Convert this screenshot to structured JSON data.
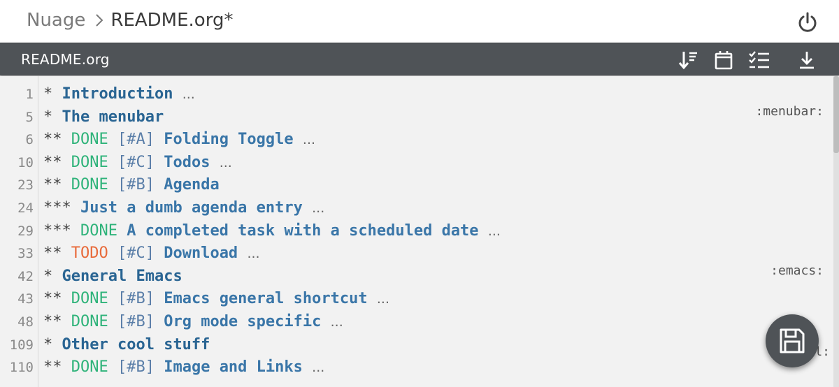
{
  "breadcrumb": {
    "root": "Nuage",
    "separator": "chevron-right-icon",
    "current": "README.org*"
  },
  "header": {
    "power_icon": "power-icon"
  },
  "toolbar": {
    "filename": "README.org",
    "buttons": [
      {
        "name": "sort-icon"
      },
      {
        "name": "calendar-icon"
      },
      {
        "name": "checklist-icon"
      },
      {
        "name": "download-icon"
      }
    ]
  },
  "editor": {
    "lines": [
      {
        "num": "1",
        "stars": "*",
        "kw": "",
        "prio": "",
        "title": "Introduction",
        "level": 1,
        "folded": true,
        "tag": ""
      },
      {
        "num": "5",
        "stars": "*",
        "kw": "",
        "prio": "",
        "title": "The menubar",
        "level": 1,
        "folded": false,
        "tag": ":menubar:"
      },
      {
        "num": "6",
        "stars": "**",
        "kw": "DONE",
        "prio": "[#A]",
        "title": "Folding Toggle",
        "level": 2,
        "folded": true,
        "tag": ""
      },
      {
        "num": "10",
        "stars": "**",
        "kw": "DONE",
        "prio": "[#C]",
        "title": "Todos",
        "level": 2,
        "folded": true,
        "tag": ""
      },
      {
        "num": "23",
        "stars": "**",
        "kw": "DONE",
        "prio": "[#B]",
        "title": "Agenda",
        "level": 2,
        "folded": false,
        "tag": ""
      },
      {
        "num": "24",
        "stars": "***",
        "kw": "",
        "prio": "",
        "title": "Just a dumb agenda entry",
        "level": 3,
        "folded": true,
        "tag": ""
      },
      {
        "num": "29",
        "stars": "***",
        "kw": "DONE",
        "prio": "",
        "title": "A completed task with a scheduled date",
        "level": 3,
        "folded": true,
        "tag": ""
      },
      {
        "num": "33",
        "stars": "**",
        "kw": "TODO",
        "prio": "[#C]",
        "title": "Download",
        "level": 2,
        "folded": true,
        "tag": ""
      },
      {
        "num": "42",
        "stars": "*",
        "kw": "",
        "prio": "",
        "title": "General Emacs",
        "level": 1,
        "folded": false,
        "tag": ":emacs:"
      },
      {
        "num": "43",
        "stars": "**",
        "kw": "DONE",
        "prio": "[#B]",
        "title": "Emacs general shortcut",
        "level": 2,
        "folded": true,
        "tag": ""
      },
      {
        "num": "48",
        "stars": "**",
        "kw": "DONE",
        "prio": "[#B]",
        "title": "Org mode specific",
        "level": 2,
        "folded": true,
        "tag": ""
      },
      {
        "num": "109",
        "stars": "*",
        "kw": "",
        "prio": "",
        "title": "Other cool stuff",
        "level": 1,
        "folded": false,
        "tag": ""
      },
      {
        "num": "110",
        "stars": "**",
        "kw": "DONE",
        "prio": "[#B]",
        "title": "Image and Links",
        "level": 2,
        "folded": true,
        "tag": ""
      }
    ],
    "ellipsis": "...",
    "partial_tag_fragment": "l:"
  },
  "fab": {
    "icon": "save-icon"
  },
  "colors": {
    "toolbar_bg": "#4f5357",
    "done": "#2fb37a",
    "todo": "#e86a3a",
    "heading": "#2a6593"
  }
}
